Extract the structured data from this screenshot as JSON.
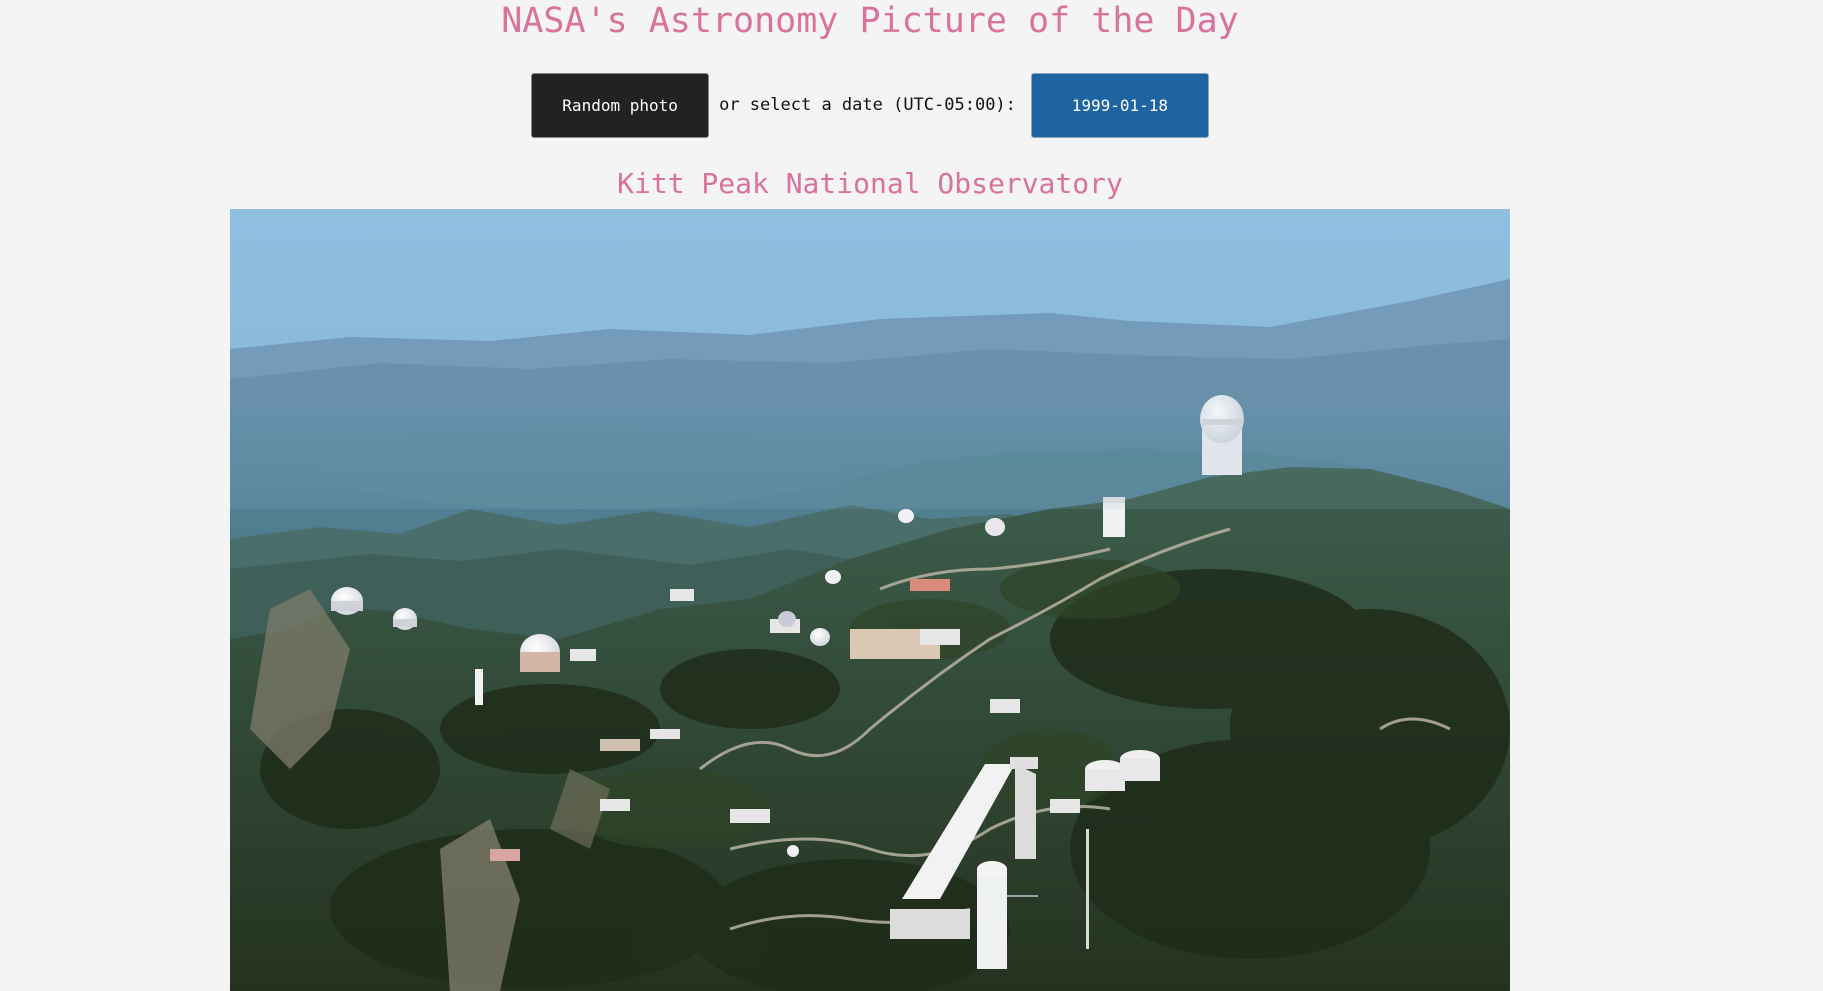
{
  "header": {
    "title": "NASA's Astronomy Picture of the Day"
  },
  "controls": {
    "random_label": "Random photo",
    "date_prompt": "or select a date (UTC-05:00):",
    "date_value": "1999-01-18"
  },
  "apod": {
    "title": "Kitt Peak National Observatory"
  },
  "colors": {
    "title_pink": "#d9739c",
    "random_button_bg": "#222222",
    "date_button_bg": "#1e64a0",
    "page_bg": "#f4f4f4"
  }
}
